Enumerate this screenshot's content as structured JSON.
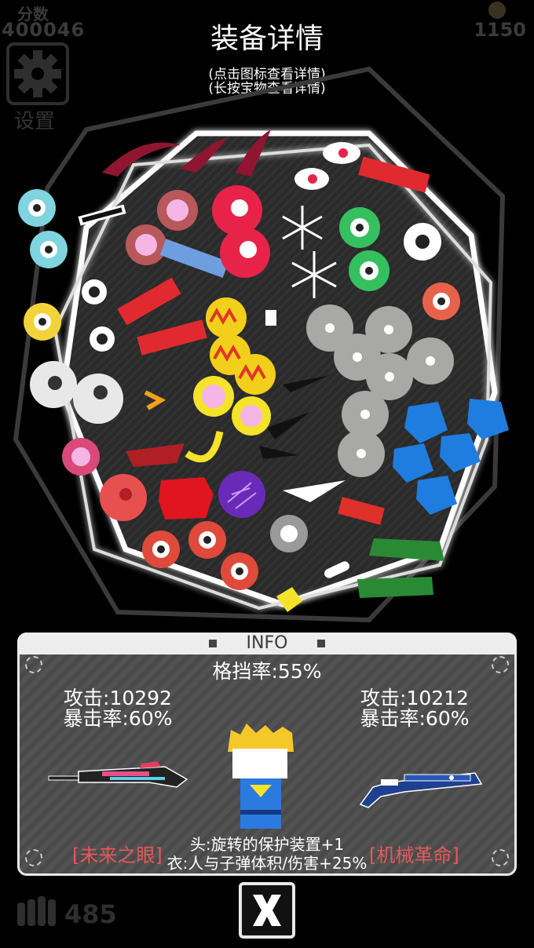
{
  "hud": {
    "score_label": "分数",
    "score_value": "400046",
    "coins": "1150",
    "settings_label": "设置",
    "ammo": "485"
  },
  "header": {
    "title": "装备详情",
    "hint_tap": "(点击图标查看详情)",
    "hint_hold": "(长按宝物查看详情)"
  },
  "info": {
    "title": "INFO",
    "block_rate": "格挡率:55%",
    "left_weapon": {
      "attack": "攻击:10292",
      "crit": "暴击率:60%",
      "name": "[未来之眼]"
    },
    "right_weapon": {
      "attack": "攻击:10212",
      "crit": "暴击率:60%",
      "name": "[机械革命]"
    },
    "bonus_head": "头:旋转的保护装置+1",
    "bonus_body": "衣:人与子弹体积/伤害+25%"
  },
  "close": {
    "label": "X"
  },
  "colors": {
    "accent_red": "#e6585a",
    "panel_bg": "#4d4d4d",
    "glow": "#ffffff"
  }
}
